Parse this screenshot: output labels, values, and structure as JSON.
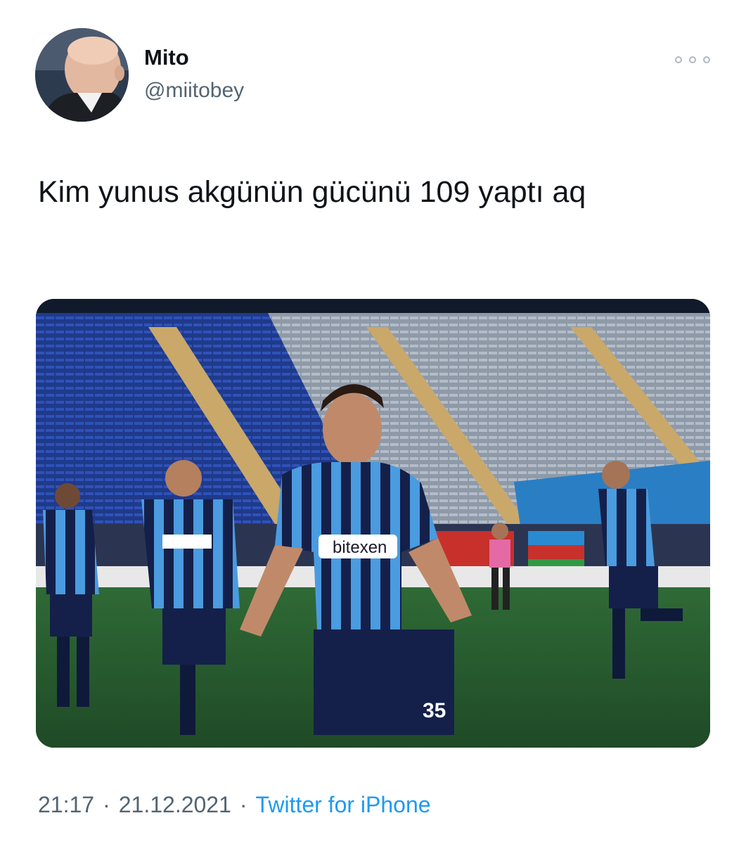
{
  "author": {
    "display_name": "Mito",
    "handle": "@miitobey"
  },
  "tweet": {
    "text": "Kim yunus akgünün gücünü 109 yaptı aq",
    "timestamp_time": "21:17",
    "timestamp_date": "21.12.2021",
    "source": "Twitter for iPhone"
  },
  "media": {
    "description_label": "photo",
    "jersey_sponsor": "bitexen",
    "jersey_number": "35"
  },
  "icons": {
    "more": "more-horizontal-icon"
  }
}
